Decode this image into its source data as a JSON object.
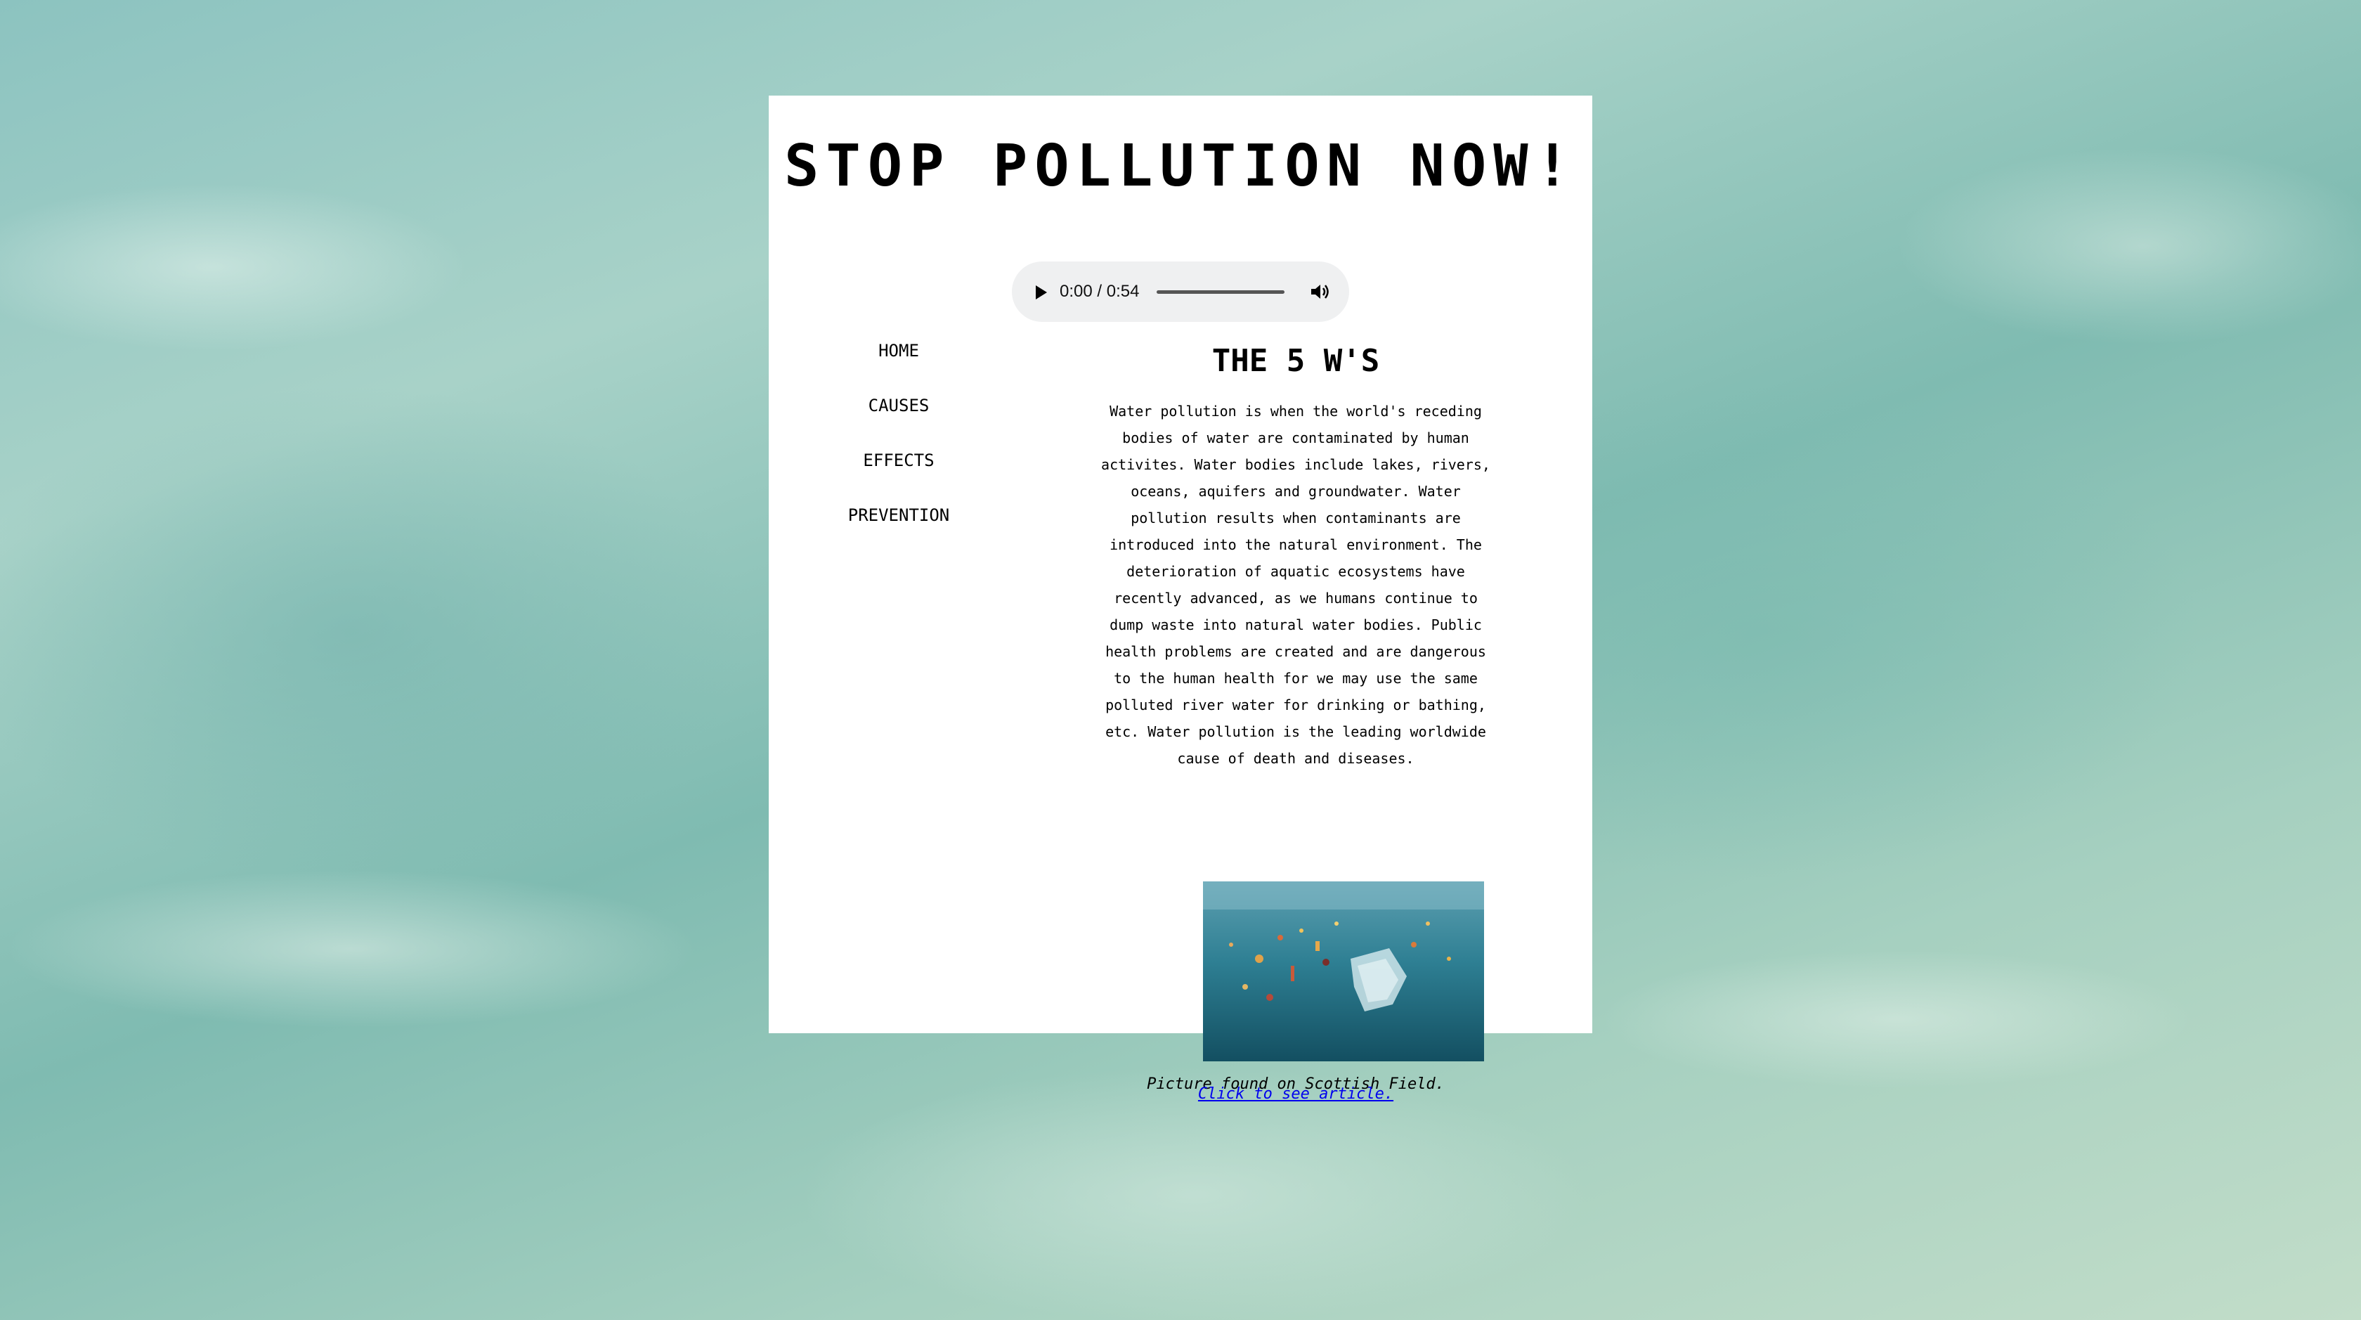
{
  "page": {
    "title": "STOP POLLUTION NOW!"
  },
  "audio": {
    "time_display": "0:00 / 0:54",
    "progress": 0,
    "icons": [
      "play-icon",
      "volume-icon"
    ]
  },
  "nav": {
    "items": [
      {
        "label": "HOME"
      },
      {
        "label": "CAUSES"
      },
      {
        "label": "EFFECTS"
      },
      {
        "label": "PREVENTION"
      }
    ]
  },
  "main": {
    "heading": "THE 5 W'S",
    "paragraph": "Water pollution is when the world's receding bodies of water are contaminated by human activites. Water bodies include lakes, rivers, oceans, aquifers and groundwater. Water pollution results when contaminants are introduced into the natural environment. The deterioration of aquatic ecosystems have recently advanced, as we humans continue to dump waste into natural water bodies. Public health problems are created and are dangerous to the human health for we may use the same polluted river water for drinking or bathing, etc. Water pollution is the leading worldwide cause of death and diseases.",
    "caption": "Picture found on Scottish Field.",
    "link_text": "Click to see article."
  },
  "colors": {
    "card_bg": "#ffffff",
    "link": "#0000ee",
    "audio_bg": "#eff0f1"
  }
}
